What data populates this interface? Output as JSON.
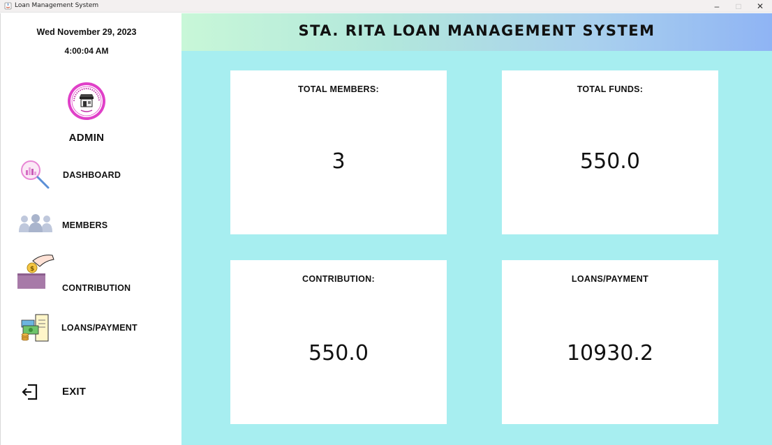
{
  "window": {
    "title": "Loan Management System",
    "controls": {
      "minimize": "–",
      "maximize": "□",
      "close": "✕"
    }
  },
  "sidebar": {
    "date": "Wed November 29, 2023",
    "time": "4:00:04 AM",
    "logo_icon": "store-seal-logo",
    "user_role": "ADMIN",
    "items": [
      {
        "label": "DASHBOARD",
        "icon": "magnifier-chart-icon"
      },
      {
        "label": "MEMBERS",
        "icon": "people-group-icon"
      },
      {
        "label": "CONTRIBUTION",
        "icon": "coin-box-icon"
      },
      {
        "label": "LOANS/PAYMENT",
        "icon": "money-receipt-icon"
      }
    ],
    "exit": {
      "label": "EXIT",
      "icon": "exit-icon"
    }
  },
  "header": {
    "title": "STA. RITA LOAN MANAGEMENT SYSTEM"
  },
  "cards": [
    {
      "title": "TOTAL MEMBERS:",
      "value": "3"
    },
    {
      "title": "TOTAL FUNDS:",
      "value": "550.0"
    },
    {
      "title": "CONTRIBUTION:",
      "value": "550.0"
    },
    {
      "title": "LOANS/PAYMENT",
      "value": "10930.2"
    }
  ],
  "colors": {
    "main_background": "#a7eef0",
    "header_gradient_start": "#c8f7d8",
    "header_gradient_end": "#8fb4f4",
    "card_background": "#ffffff",
    "logo_accent": "#e040c8"
  }
}
